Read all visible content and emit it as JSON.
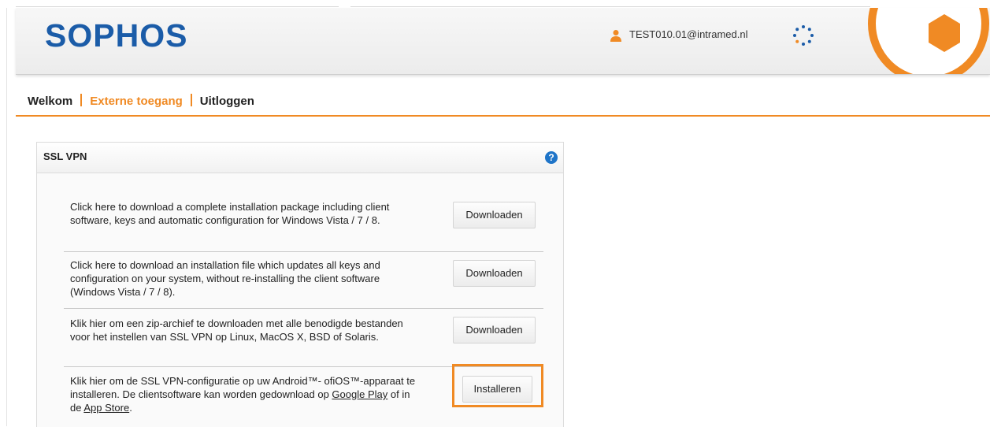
{
  "header": {
    "logo": "SOPHOS",
    "user_email": "TEST010.01@intramed.nl"
  },
  "nav": {
    "items": [
      {
        "label": "Welkom"
      },
      {
        "label": "Externe toegang"
      },
      {
        "label": "Uitloggen"
      }
    ]
  },
  "panel": {
    "title": "SSL VPN",
    "help": "?",
    "rows": [
      {
        "text": "Click here to download a complete installation package including client software, keys and automatic configuration for Windows Vista / 7 / 8.",
        "button": "Downloaden"
      },
      {
        "text": "Click here to download an installation file which updates all keys and configuration on your system, without re-installing the client software (Windows Vista / 7 / 8).",
        "button": "Downloaden"
      },
      {
        "text": "Klik hier om een zip-archief te downloaden met alle benodigde bestanden voor het instellen van SSL VPN op Linux, MacOS X, BSD of Solaris.",
        "button": "Downloaden"
      },
      {
        "text_before": "Klik hier om de SSL VPN-configuratie op uw Android™- ofiOS™-apparaat te installeren. De clientsoftware kan worden gedownload op ",
        "link1": "Google Play",
        "text_middle": " of in de ",
        "link2": "App Store",
        "text_after": ".",
        "button": "Installeren"
      }
    ]
  },
  "colors": {
    "brand_blue": "#1b5ca8",
    "accent_orange": "#f08a24",
    "help_blue": "#1e74c8"
  },
  "icons": {
    "user": "user-icon",
    "spinner": "loading-spinner-icon",
    "help": "help-icon",
    "badge": "sophos-hexagon-badge"
  }
}
